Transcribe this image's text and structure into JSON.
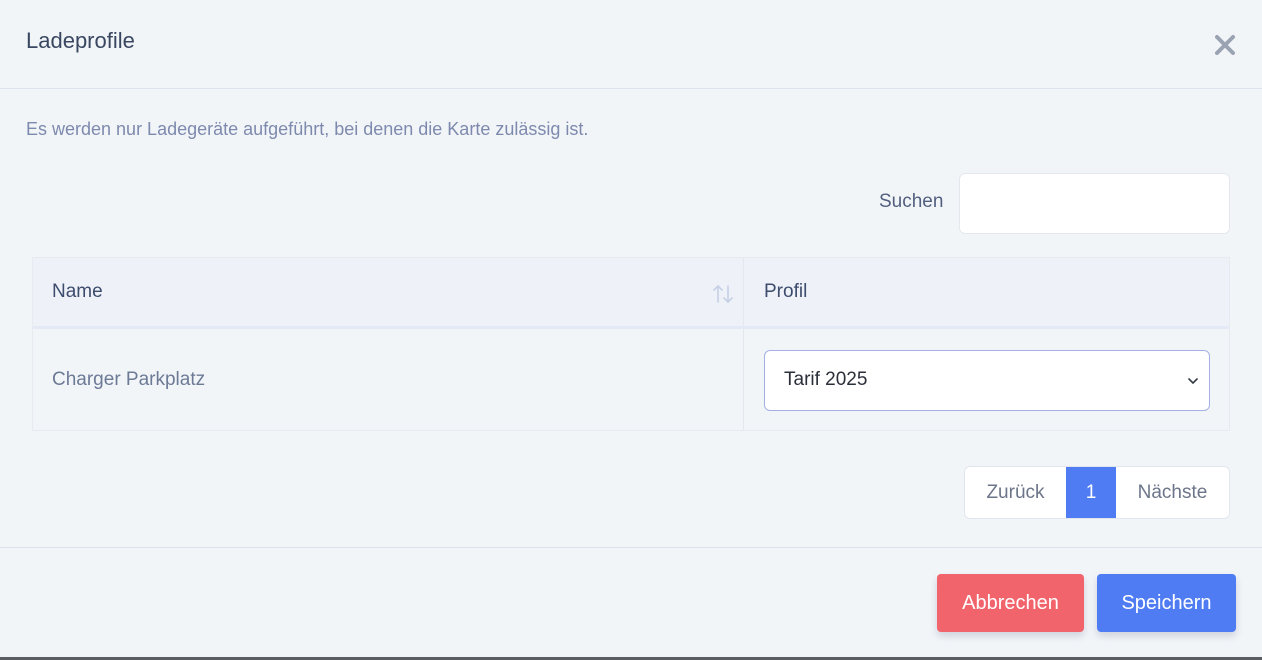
{
  "modal": {
    "title": "Ladeprofile",
    "close_icon": "close-icon",
    "info_text": "Es werden nur Ladegeräte aufgeführt, bei denen die Karte zulässig ist."
  },
  "search": {
    "label": "Suchen",
    "value": "",
    "placeholder": ""
  },
  "table": {
    "columns": [
      {
        "label": "Name",
        "sortable": true,
        "sort_icon": "sort-arrows-icon"
      },
      {
        "label": "Profil",
        "sortable": false
      }
    ],
    "rows": [
      {
        "name": "Charger Parkplatz",
        "profil": "Tarif 2025"
      }
    ]
  },
  "pagination": {
    "prev_label": "Zurück",
    "current_page": "1",
    "next_label": "Nächste"
  },
  "footer": {
    "cancel_label": "Abbrechen",
    "save_label": "Speichern"
  },
  "colors": {
    "primary": "#4f7cf3",
    "danger": "#f2646c",
    "background": "#f2f5f8",
    "heading_text": "#3a4761",
    "muted_text": "#7d8aae"
  }
}
